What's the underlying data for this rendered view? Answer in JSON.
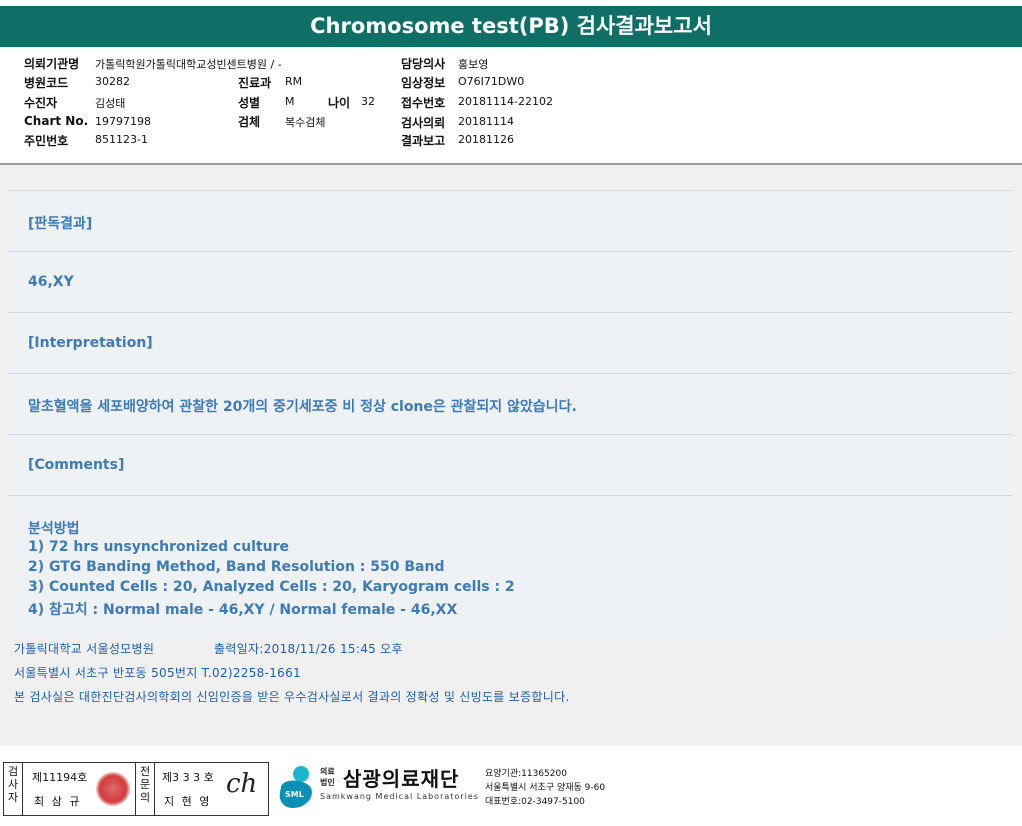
{
  "title": "Chromosome test(PB) 검사결과보고서",
  "header": {
    "institution_label": "의뢰기관명",
    "institution_value": "가톨릭학원가톨릭대학교성빈센트병원 / -",
    "doctor_label": "담당의사",
    "doctor_value": "홍보영",
    "hospital_code_label": "병원코드",
    "hospital_code_value": "30282",
    "dept_label": "진료과",
    "dept_value": "RM",
    "clinical_info_label": "임상정보",
    "clinical_info_value": "O76I71DW0",
    "receiver_label": "수진자",
    "receiver_value": "김성태",
    "sex_label": "성별",
    "sex_value": "M",
    "age_label": "나이",
    "age_value": "32",
    "receipt_label": "접수번호",
    "receipt_value": "20181114-22102",
    "chart_label": "Chart No.",
    "chart_value": "19797198",
    "specimen_label": "검체",
    "specimen_value": "복수검체",
    "request_label": "검사의뢰",
    "request_value": "20181114",
    "id_label": "주민번호",
    "id_value": "851123-1",
    "report_label": "결과보고",
    "report_value": "20181126"
  },
  "results": {
    "judgement_heading": "[판독결과]",
    "karyotype": "46,XY",
    "interpretation_heading": "[Interpretation]",
    "interpretation_text": "말초혈액을 세포배양하여 관찰한 20개의 중기세포중 비 정상 clone은 관찰되지 않았습니다.",
    "comments_heading": "[Comments]",
    "method_heading": "분석방법",
    "method_lines": [
      "1) 72 hrs unsynchronized culture",
      "2) GTG Banding Method, Band Resolution : 550 Band",
      "3) Counted Cells : 20, Analyzed Cells : 20, Karyogram cells : 2",
      "4) 참고치 : Normal male - 46,XY / Normal female - 46,XX"
    ]
  },
  "footer": {
    "hospital": "가톨릭대학교 서울성모병원",
    "print_date": "출력일자:2018/11/26 15:45 오후",
    "address": "서울특별시 서초구 반포동 505번지 T.02)2258-1661",
    "certification": "본 검사실은 대한진단검사의학회의 신임인증을 받은 우수검사실로서 결과의 정확성 및 신빙도를 보증합니다."
  },
  "signature": {
    "tester_label": "검사자",
    "tester_no": "제11194호",
    "tester_name": "최 삼 규",
    "specialist_label": "전문의",
    "specialist_no": "제3 3 3 호",
    "specialist_name": "지 현 영",
    "signature_text": "ch"
  },
  "org": {
    "corp_label_1": "의료",
    "corp_label_2": "법인",
    "name": "삼광의료재단",
    "name_en": "Samkwang Medical Laboratories",
    "logo_text": "SML",
    "code_line": "요양기관:11365200",
    "address_line": "서울특별시 서초구 양재동 9-60",
    "phone_line": "대표번호:02-3497-5100"
  },
  "colors": {
    "title_bg": "#0f6f66",
    "result_text": "#3d7ab8",
    "panel_bg": "#eef2f5",
    "footer_text": "#1f5fa8"
  }
}
